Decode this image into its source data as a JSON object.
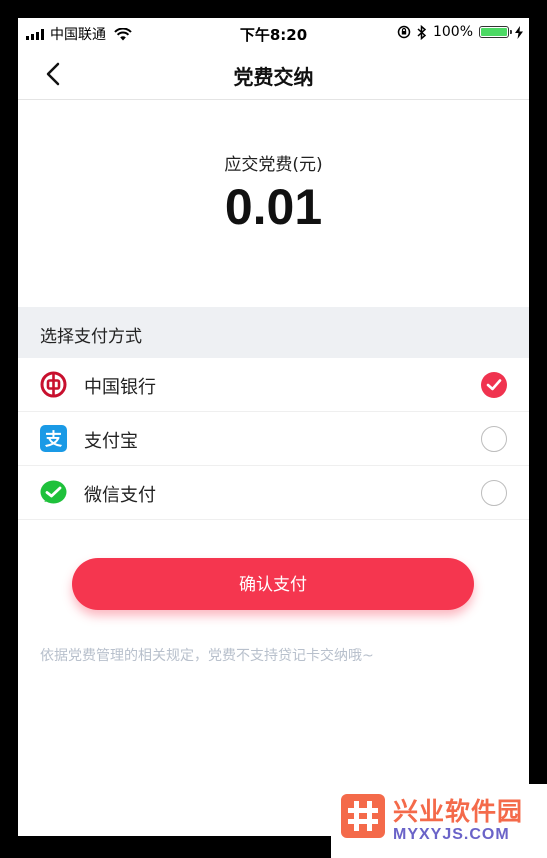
{
  "status_bar": {
    "carrier": "中国联通",
    "time": "下午8:20",
    "battery": "100%",
    "battery_level": 1.0
  },
  "nav": {
    "title": "党费交纳",
    "back_icon": "chevron-left-icon"
  },
  "amount": {
    "label": "应交党费(元)",
    "value": "0.01"
  },
  "payment": {
    "section_title": "选择支付方式",
    "methods": [
      {
        "label": "中国银行",
        "icon": "bank-of-china-icon",
        "selected": true
      },
      {
        "label": "支付宝",
        "icon": "alipay-icon",
        "selected": false
      },
      {
        "label": "微信支付",
        "icon": "wechat-pay-icon",
        "selected": false
      }
    ]
  },
  "confirm_button": "确认支付",
  "notice": "依据党费管理的相关规定，党费不支持贷记卡交纳哦~",
  "watermark": {
    "title": "兴业软件园",
    "subtitle": "MYXYJS.COM"
  },
  "colors": {
    "accent": "#f5364f",
    "section_bg": "#eef0f3",
    "notice": "#b8c0cc",
    "alipay": "#1a9ae6",
    "wechat": "#1fc13b",
    "boc": "#c8102e"
  }
}
